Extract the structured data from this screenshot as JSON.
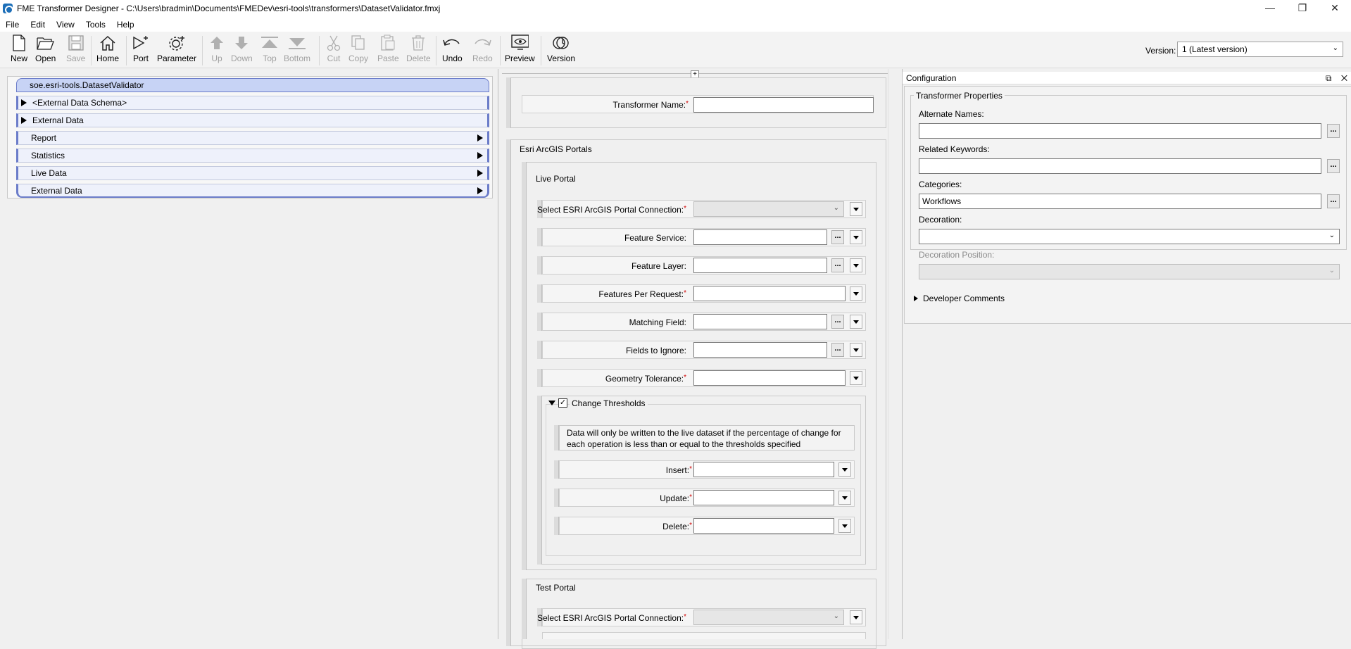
{
  "window": {
    "title": "FME Transformer Designer - C:\\Users\\bradmin\\Documents\\FMEDev\\esri-tools\\transformers\\DatasetValidator.fmxj",
    "minimize": "—",
    "maximize": "❐",
    "close": "✕"
  },
  "menu": [
    "File",
    "Edit",
    "View",
    "Tools",
    "Help"
  ],
  "toolbar": {
    "new": "New",
    "open": "Open",
    "save": "Save",
    "home": "Home",
    "port": "Port",
    "parameter": "Parameter",
    "up": "Up",
    "down": "Down",
    "top": "Top",
    "bottom": "Bottom",
    "cut": "Cut",
    "copy": "Copy",
    "paste": "Paste",
    "delete": "Delete",
    "undo": "Undo",
    "redo": "Redo",
    "preview": "Preview",
    "version": "Version",
    "version_label": "Version:",
    "version_value": "1 (Latest version)"
  },
  "tree": {
    "root": "soe.esri-tools.DatasetValidator",
    "items": [
      "<External Data Schema>",
      "External Data",
      "Report",
      "Statistics",
      "Live Data",
      "External Data"
    ]
  },
  "form": {
    "transformer_name_label": "Transformer Name:",
    "esri_group": "Esri ArcGIS Portals",
    "live_portal": "Live Portal",
    "test_portal": "Test Portal",
    "select_connection_label": "Select ESRI ArcGIS Portal Connection:",
    "feature_service_label": "Feature Service:",
    "feature_layer_label": "Feature Layer:",
    "features_per_request_label": "Features Per Request:",
    "matching_field_label": "Matching Field:",
    "fields_to_ignore_label": "Fields to Ignore:",
    "geometry_tolerance_label": "Geometry Tolerance:",
    "change_thresholds": "Change Thresholds",
    "thresholds_info": "Data will only be written to the live dataset if the percentage of change for each operation is less than or equal to the thresholds specified",
    "insert_label": "Insert:",
    "update_label": "Update:",
    "delete_label": "Delete:",
    "required_mark": "*",
    "dots": "..."
  },
  "config": {
    "title": "Configuration",
    "section": "Transformer Properties",
    "alternate_names_label": "Alternate Names:",
    "related_keywords_label": "Related Keywords:",
    "categories_label": "Categories:",
    "categories_value": "Workflows",
    "decoration_label": "Decoration:",
    "decoration_position_label": "Decoration Position:",
    "developer_comments": "Developer Comments",
    "float_icon": "⧉",
    "close_icon": "✕"
  }
}
